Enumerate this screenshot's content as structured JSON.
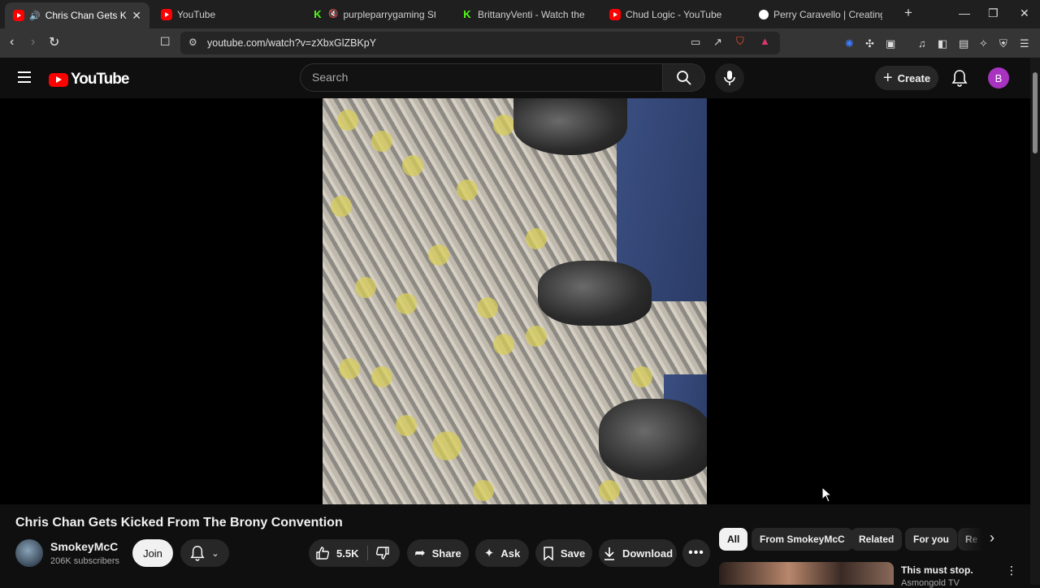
{
  "browser": {
    "tabs": [
      {
        "title": "Chris Chan Gets Kicked F",
        "favicon": "youtube",
        "active": true
      },
      {
        "title": "YouTube",
        "favicon": "youtube",
        "active": false
      },
      {
        "title": "purpleparrygaming Stream -",
        "favicon": "kick",
        "active": false
      },
      {
        "title": "BrittanyVenti - Watch the VOD o",
        "favicon": "kick",
        "active": false
      },
      {
        "title": "Chud Logic - YouTube",
        "favicon": "youtube",
        "active": false
      },
      {
        "title": "Perry Caravello | Creating Come",
        "favicon": "patreon",
        "active": false
      }
    ],
    "new_tab": "+",
    "url": "youtube.com/watch?v=zXbxGlZBKpY"
  },
  "youtube": {
    "logo_text": "YouTube",
    "search_placeholder": "Search",
    "create_label": "Create",
    "avatar_letter": "B"
  },
  "video": {
    "title": "Chris Chan Gets Kicked From The Brony Convention",
    "channel": "SmokeyMcC",
    "subscribers": "206K subscribers",
    "join_label": "Join",
    "likes": "5.5K",
    "share_label": "Share",
    "ask_label": "Ask",
    "save_label": "Save",
    "download_label": "Download"
  },
  "chips": [
    "All",
    "From SmokeyMcC",
    "Related",
    "For you",
    "Re"
  ],
  "recommendation": {
    "title": "This must stop.",
    "channel": "Asmongold TV"
  },
  "colors": {
    "background": "#0f0f0f",
    "brand_red": "#ff0000",
    "avatar": "#a833c1"
  }
}
